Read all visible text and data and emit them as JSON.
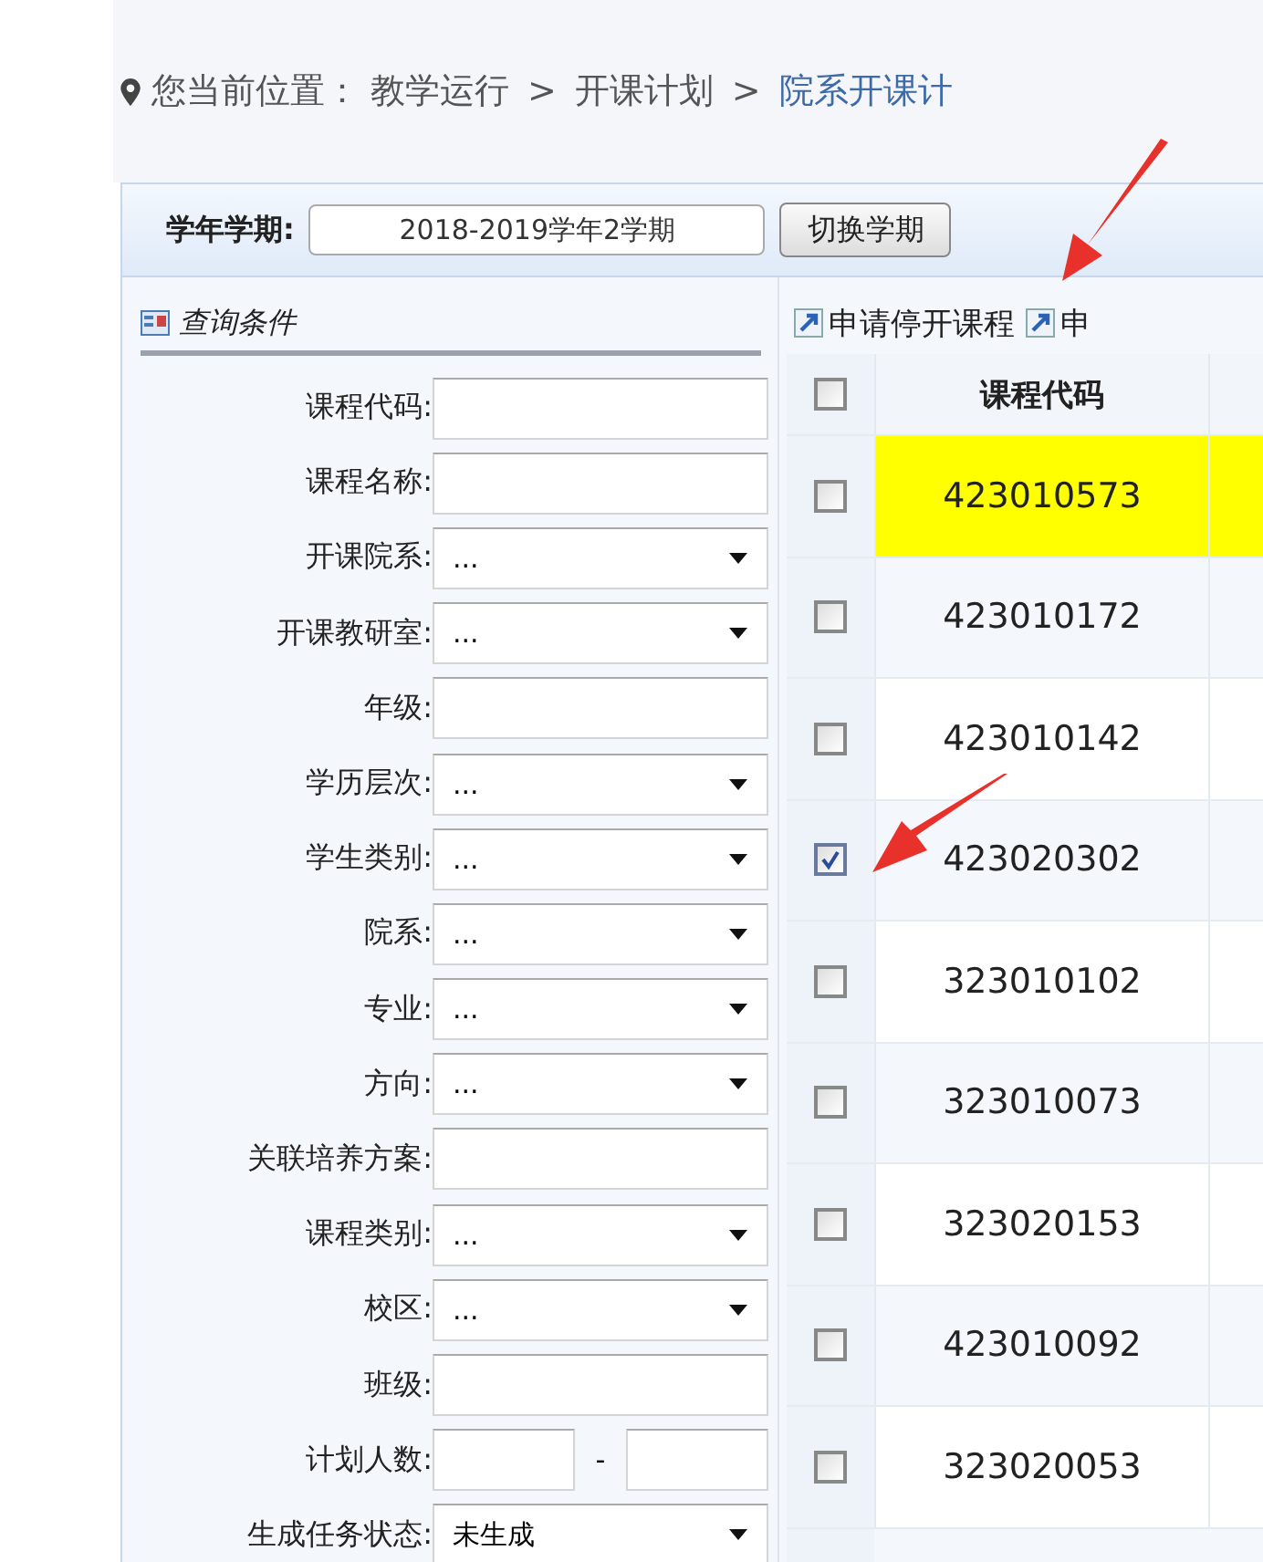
{
  "breadcrumb": {
    "label": "您当前位置：",
    "separators": [
      ">",
      ">"
    ],
    "items": [
      {
        "text": "教学运行",
        "current": false
      },
      {
        "text": "开课计划",
        "current": false
      },
      {
        "text": "院系开课计",
        "current": true
      }
    ]
  },
  "term": {
    "label": "学年学期:",
    "value": "2018-2019学年2学期",
    "button": "切换学期"
  },
  "query": {
    "title": "查询条件",
    "fields": [
      {
        "label": "课程代码:",
        "kind": "text"
      },
      {
        "label": "课程名称:",
        "kind": "text"
      },
      {
        "label": "开课院系:",
        "kind": "select",
        "value": "..."
      },
      {
        "label": "开课教研室:",
        "kind": "select",
        "value": "..."
      },
      {
        "label": "年级:",
        "kind": "text"
      },
      {
        "label": "学历层次:",
        "kind": "select",
        "value": "..."
      },
      {
        "label": "学生类别:",
        "kind": "select",
        "value": "..."
      },
      {
        "label": "院系:",
        "kind": "select",
        "value": "..."
      },
      {
        "label": "专业:",
        "kind": "select",
        "value": "..."
      },
      {
        "label": "方向:",
        "kind": "select",
        "value": "..."
      },
      {
        "label": "关联培养方案:",
        "kind": "text"
      },
      {
        "label": "课程类别:",
        "kind": "select",
        "value": "..."
      },
      {
        "label": "校区:",
        "kind": "select",
        "value": "..."
      },
      {
        "label": "班级:",
        "kind": "text"
      },
      {
        "label": "计划人数:",
        "kind": "range",
        "separator": "-"
      },
      {
        "label": "生成任务状态:",
        "kind": "select",
        "value": "未生成"
      }
    ]
  },
  "actions": [
    "申请停开课程",
    "申"
  ],
  "table": {
    "header": {
      "checked": false,
      "column": "课程代码"
    },
    "rows": [
      {
        "code": "423010573",
        "checked": false,
        "highlighted": true
      },
      {
        "code": "423010172",
        "checked": false,
        "highlighted": false
      },
      {
        "code": "423010142",
        "checked": false,
        "highlighted": false
      },
      {
        "code": "423020302",
        "checked": true,
        "highlighted": false
      },
      {
        "code": "323010102",
        "checked": false,
        "highlighted": false
      },
      {
        "code": "323010073",
        "checked": false,
        "highlighted": false
      },
      {
        "code": "323020153",
        "checked": false,
        "highlighted": false
      },
      {
        "code": "423010092",
        "checked": false,
        "highlighted": false
      },
      {
        "code": "323020053",
        "checked": false,
        "highlighted": false
      }
    ]
  }
}
